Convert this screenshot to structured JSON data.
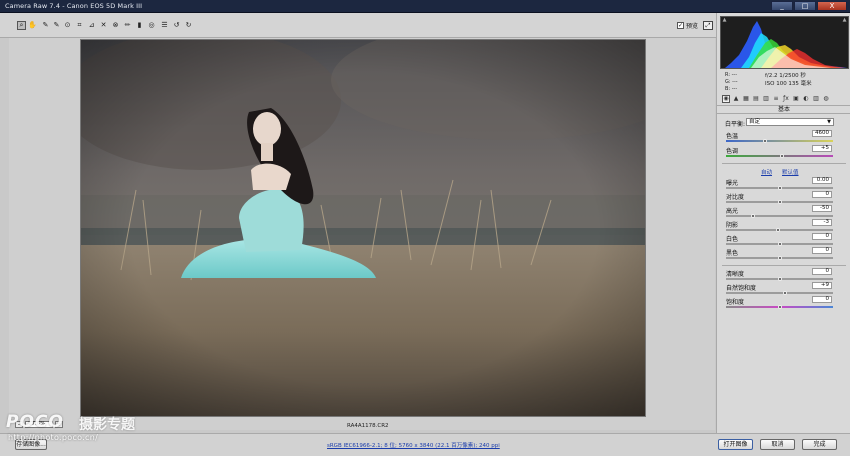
{
  "window": {
    "title": "Camera Raw 7.4 - Canon EOS 5D Mark III",
    "minimize": "_",
    "maximize": "□",
    "close": "X"
  },
  "toolbar": {
    "tools": [
      {
        "name": "zoom-tool-icon",
        "glyph": "⌕"
      },
      {
        "name": "hand-tool-icon",
        "glyph": "✋"
      },
      {
        "name": "white-balance-tool-icon",
        "glyph": "✎"
      },
      {
        "name": "color-sampler-tool-icon",
        "glyph": "✎"
      },
      {
        "name": "targeted-adjustment-tool-icon",
        "glyph": "⊙"
      },
      {
        "name": "crop-tool-icon",
        "glyph": "⌗"
      },
      {
        "name": "straighten-tool-icon",
        "glyph": "⊿"
      },
      {
        "name": "spot-removal-tool-icon",
        "glyph": "✕"
      },
      {
        "name": "red-eye-tool-icon",
        "glyph": "⊗"
      },
      {
        "name": "adjustment-brush-icon",
        "glyph": "✏"
      },
      {
        "name": "graduated-filter-icon",
        "glyph": "▮"
      },
      {
        "name": "radial-filter-icon",
        "glyph": "◎"
      },
      {
        "name": "preferences-icon",
        "glyph": "☰"
      },
      {
        "name": "rotate-left-icon",
        "glyph": "↺"
      },
      {
        "name": "rotate-right-icon",
        "glyph": "↻"
      }
    ],
    "preview_label": "预览",
    "preview_checked": "✓",
    "fullscreen_glyph": "⤢"
  },
  "zoom": {
    "minus": "-",
    "value": "17.6%",
    "plus": "+"
  },
  "filename": "RA4A1178.CR2",
  "workflow_link": "sRGB IEC61966-2.1; 8 位; 5760 x 3840 (22.1 百万像素); 240 ppi",
  "buttons": {
    "save": "存储图像...",
    "open": "打开图像",
    "cancel": "取消",
    "done": "完成"
  },
  "watermark": {
    "brand": "POCO",
    "title": "摄影专题",
    "url": "http://photo.poco.cn/"
  },
  "histogram": {
    "channels": [
      "blue",
      "cyan",
      "green",
      "yellow",
      "red"
    ]
  },
  "readout": {
    "r": "R:  ---",
    "g": "G:  ---",
    "b": "B:  ---",
    "exif_line1": "f/2.2   1/2500 秒",
    "exif_line2": "ISO 100   135 毫米"
  },
  "panel": {
    "header": "基本",
    "tab_glyphs": [
      "◉",
      "▲",
      "▦",
      "▤",
      "▥",
      "≡",
      "ƒx",
      "▣",
      "◐",
      "▥",
      "◍"
    ],
    "white_balance_label": "白平衡:",
    "white_balance_value": "自定",
    "auto_link": "自动",
    "default_link": "默认值",
    "sliders": [
      {
        "key": "temperature",
        "label": "色温",
        "value": "4600",
        "pos": 0.36,
        "style": "temp"
      },
      {
        "key": "tint",
        "label": "色调",
        "value": "+5",
        "pos": 0.52,
        "style": "tint"
      },
      {
        "key": "exposure",
        "label": "曝光",
        "value": "0.00",
        "pos": 0.5,
        "style": "gray"
      },
      {
        "key": "contrast",
        "label": "对比度",
        "value": "0",
        "pos": 0.5,
        "style": "gray"
      },
      {
        "key": "highlights",
        "label": "高光",
        "value": "-50",
        "pos": 0.25,
        "style": "gray"
      },
      {
        "key": "shadows",
        "label": "阴影",
        "value": "-3",
        "pos": 0.49,
        "style": "gray"
      },
      {
        "key": "whites",
        "label": "白色",
        "value": "0",
        "pos": 0.5,
        "style": "gray"
      },
      {
        "key": "blacks",
        "label": "黑色",
        "value": "0",
        "pos": 0.5,
        "style": "gray"
      },
      {
        "key": "clarity",
        "label": "清晰度",
        "value": "0",
        "pos": 0.5,
        "style": "gray"
      },
      {
        "key": "vibrance",
        "label": "自然饱和度",
        "value": "+9",
        "pos": 0.55,
        "style": "gray"
      },
      {
        "key": "saturation",
        "label": "饱和度",
        "value": "0",
        "pos": 0.5,
        "style": "sat"
      }
    ]
  }
}
